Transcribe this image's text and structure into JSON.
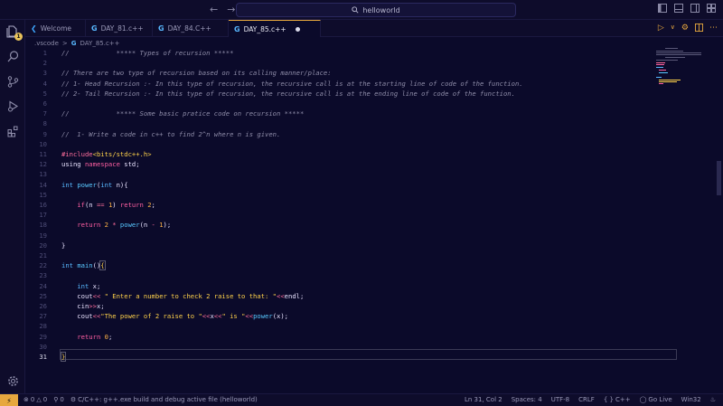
{
  "titlebar": {
    "search_text": "helloworld",
    "back_glyph": "←",
    "forward_glyph": "→",
    "search_icon": "search-icon",
    "controls": [
      "layout-sidebar-icon",
      "layout-panel-icon",
      "layout-aux-icon",
      "customize-layout-icon"
    ]
  },
  "activitybar": {
    "explorer_badge": "1",
    "icons": [
      "explorer-icon",
      "search-icon",
      "source-control-icon",
      "run-debug-icon",
      "extensions-icon",
      "settings-gear-icon"
    ]
  },
  "tabs": [
    {
      "label": "Welcome",
      "icon": "vscode-logo-icon",
      "active": false
    },
    {
      "label": "DAY_81.c++",
      "icon": "cpp-file-icon",
      "active": false
    },
    {
      "label": "DAY_84.C++",
      "icon": "cpp-file-icon",
      "active": false
    },
    {
      "label": "DAY_85.c++",
      "icon": "cpp-file-icon",
      "active": true,
      "dirty": true
    }
  ],
  "breadcrumb": {
    "folder": ".vscode",
    "separator": ">",
    "file": "DAY_85.c++"
  },
  "editor": {
    "current_line": 31,
    "line_numbers": [
      "1",
      "2",
      "3",
      "4",
      "5",
      "6",
      "7",
      "8",
      "9",
      "10",
      "11",
      "12",
      "13",
      "14",
      "15",
      "16",
      "17",
      "18",
      "19",
      "20",
      "21",
      "22",
      "23",
      "24",
      "25",
      "26",
      "27",
      "28",
      "29",
      "30",
      "31"
    ]
  },
  "statusbar": {
    "remote_glyph": "⚡",
    "errors": "0",
    "warnings": "0",
    "ports": "0",
    "task": "C/C++: g++.exe build and debug active file (helloworld)",
    "position": "Ln 31, Col 2",
    "spaces": "Spaces: 4",
    "encoding": "UTF-8",
    "eol": "CRLF",
    "language": "C++",
    "go_live": "Go Live",
    "platform": "Win32"
  },
  "colors": {
    "accent": "#e7a83e",
    "background": "#0b0a2a",
    "keyword": "#ff5fa2",
    "function": "#58c8ff",
    "string": "#ffd24a"
  }
}
